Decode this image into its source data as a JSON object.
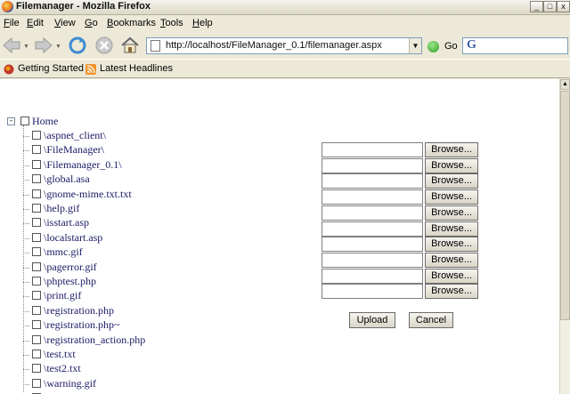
{
  "window": {
    "title": "Filemanager - Mozilla Firefox",
    "minimize": "_",
    "maximize": "□",
    "close": "x"
  },
  "menu": [
    {
      "accel": "F",
      "rest": "ile"
    },
    {
      "accel": "E",
      "rest": "dit"
    },
    {
      "accel": "V",
      "rest": "iew"
    },
    {
      "accel": "G",
      "rest": "o"
    },
    {
      "accel": "B",
      "rest": "ookmarks"
    },
    {
      "accel": "T",
      "rest": "ools"
    },
    {
      "accel": "H",
      "rest": "elp"
    }
  ],
  "toolbar": {
    "url": "http://localhost/FileManager_0.1/filemanager.aspx",
    "go_label": "Go",
    "search_engine_glyph": "G",
    "search_value": ""
  },
  "bookmarks": [
    {
      "label": "Getting Started",
      "icon": "firefox-icon"
    },
    {
      "label": "Latest Headlines",
      "icon": "rss-icon"
    }
  ],
  "tree": {
    "root_label": "Home",
    "expander": "-",
    "items": [
      "\\aspnet_client\\",
      "\\FileManager\\",
      "\\Filemanager_0.1\\",
      "\\global.asa",
      "\\gnome-mime.txt.txt",
      "\\help.gif",
      "\\isstart.asp",
      "\\localstart.asp",
      "\\mmc.gif",
      "\\pagerror.gif",
      "\\phptest.php",
      "\\print.gif",
      "\\registration.php",
      "\\registration.php~",
      "\\registration_action.php",
      "\\test.txt",
      "\\test2.txt",
      "\\warning.gif",
      "\\web.gif"
    ]
  },
  "upload": {
    "browse_label": "Browse...",
    "rows": 10,
    "upload_label": "Upload",
    "cancel_label": "Cancel"
  },
  "colors": {
    "tree_text": "#1a1a66",
    "chrome": "#ece9d8"
  }
}
